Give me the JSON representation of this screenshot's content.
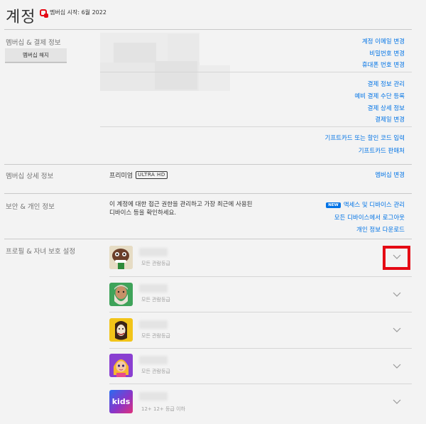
{
  "page_title": "계정",
  "member_since": "멤버십 시작: 6월 2022",
  "membership": {
    "label": "멤버십 & 결제 정보",
    "cancel_button": "멤버십 해지",
    "links_account": [
      "계정 이메일 변경",
      "비밀번호 변경",
      "휴대폰 번호 변경"
    ],
    "links_payment": [
      "결제 정보 관리",
      "예비 결제 수단 등록",
      "결제 상세 정보",
      "결제일 변경"
    ],
    "links_gift": [
      "기프트카드 또는 할인 코드 입력",
      "기프트카드 판매처"
    ]
  },
  "plan": {
    "label": "멤버십 상세 정보",
    "plan_name": "프리미엄",
    "badge": "ULTRA HD",
    "change_link": "멤버십 변경"
  },
  "security": {
    "label": "보안 & 개인 정보",
    "description": "이 계정에 대한 접근 권한을 관리하고 가장 최근에 사용된 디바이스 등을 확인하세요.",
    "new_badge": "NEW",
    "links": [
      "액세스 및 디바이스 관리",
      "모든 디바이스에서 로그아웃",
      "개인 정보 다운로드"
    ]
  },
  "profiles": {
    "label": "프로필 & 자녀 보호 설정",
    "items": [
      {
        "meta": "모든 관람등급",
        "avatar": "brown-creature-avatar"
      },
      {
        "meta": "모든 관람등급",
        "avatar": "green-bearded-man-avatar"
      },
      {
        "meta": "모든 관람등급",
        "avatar": "yellow-mask-avatar"
      },
      {
        "meta": "모든 관람등급",
        "avatar": "purple-girl-avatar"
      },
      {
        "meta": "12+ 12+ 등급 이하",
        "avatar": "kids-avatar",
        "avatar_text": "kids"
      }
    ]
  },
  "colors": {
    "accent_link": "#0073e6",
    "brand_red": "#e50914",
    "background": "#f3f3f3"
  }
}
